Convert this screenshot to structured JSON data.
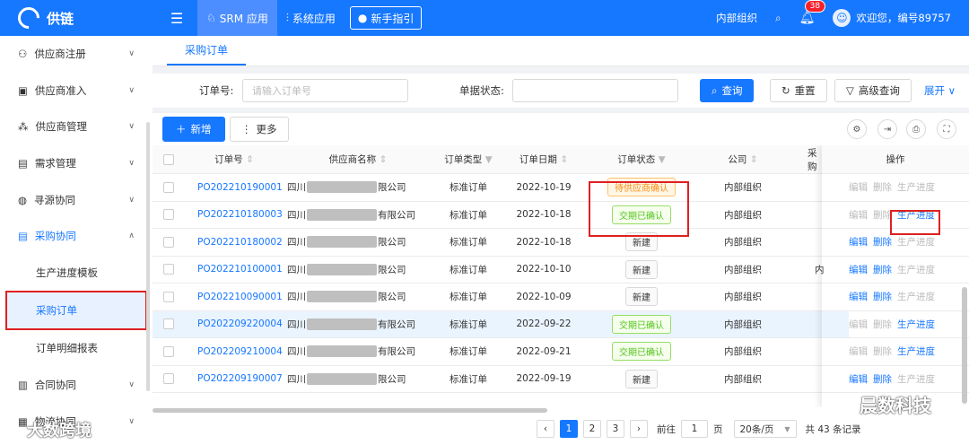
{
  "app": {
    "logo_text": "供链"
  },
  "topbar": {
    "tabs": [
      {
        "label": "SRM 应用"
      },
      {
        "label": "系统应用"
      }
    ],
    "guide_label": "新手指引",
    "org_label": "内部组织",
    "notification_count": "38",
    "welcome": "欢迎您，编号89757"
  },
  "sidebar": {
    "items": [
      {
        "label": "供应商注册"
      },
      {
        "label": "供应商准入"
      },
      {
        "label": "供应商管理"
      },
      {
        "label": "需求管理"
      },
      {
        "label": "寻源协同"
      },
      {
        "label": "采购协同"
      }
    ],
    "sub_items": [
      {
        "label": "生产进度模板"
      },
      {
        "label": "采购订单"
      },
      {
        "label": "订单明细报表"
      }
    ],
    "items_after": [
      {
        "label": "合同协同"
      },
      {
        "label": "物流协同"
      }
    ]
  },
  "page_tab": "采购订单",
  "filter": {
    "order_no_label": "订单号:",
    "order_no_placeholder": "请输入订单号",
    "status_label": "单据状态:",
    "query_label": "查询",
    "reset_label": "重置",
    "advanced_label": "高级查询",
    "expand_label": "展开"
  },
  "toolbar": {
    "add_label": "新增",
    "more_label": "更多"
  },
  "table": {
    "headers": [
      "订单号",
      "供应商名称",
      "订单类型",
      "订单日期",
      "订单状态",
      "公司",
      "采购",
      "操作"
    ],
    "rows": [
      {
        "order_no": "PO202210190001",
        "supplier_prefix": "四川",
        "supplier_suffix": "限公司",
        "type": "标准订单",
        "date": "2022-10-19",
        "status": "待供应商确认",
        "status_style": "orange",
        "company": "内部组织",
        "purchaser": "",
        "ops": [
          {
            "label": "编辑",
            "on": false
          },
          {
            "label": "删除",
            "on": false
          },
          {
            "label": "生产进度",
            "on": false
          }
        ]
      },
      {
        "order_no": "PO202210180003",
        "supplier_prefix": "四川",
        "supplier_suffix": "有限公司",
        "type": "标准订单",
        "date": "2022-10-18",
        "status": "交期已确认",
        "status_style": "green",
        "company": "内部组织",
        "purchaser": "",
        "ops": [
          {
            "label": "编辑",
            "on": false
          },
          {
            "label": "删除",
            "on": false
          },
          {
            "label": "生产进度",
            "on": true
          }
        ]
      },
      {
        "order_no": "PO202210180002",
        "supplier_prefix": "四川",
        "supplier_suffix": "限公司",
        "type": "标准订单",
        "date": "2022-10-18",
        "status": "新建",
        "status_style": "gray",
        "company": "内部组织",
        "purchaser": "",
        "ops": [
          {
            "label": "编辑",
            "on": true
          },
          {
            "label": "删除",
            "on": true
          },
          {
            "label": "生产进度",
            "on": false
          }
        ]
      },
      {
        "order_no": "PO202210100001",
        "supplier_prefix": "四川",
        "supplier_suffix": "限公司",
        "type": "标准订单",
        "date": "2022-10-10",
        "status": "新建",
        "status_style": "gray",
        "company": "内部组织",
        "purchaser": "内",
        "ops": [
          {
            "label": "编辑",
            "on": true
          },
          {
            "label": "删除",
            "on": true
          },
          {
            "label": "生产进度",
            "on": false
          }
        ]
      },
      {
        "order_no": "PO202210090001",
        "supplier_prefix": "四川",
        "supplier_suffix": "限公司",
        "type": "标准订单",
        "date": "2022-10-09",
        "status": "新建",
        "status_style": "gray",
        "company": "内部组织",
        "purchaser": "",
        "ops": [
          {
            "label": "编辑",
            "on": true
          },
          {
            "label": "删除",
            "on": true
          },
          {
            "label": "生产进度",
            "on": false
          }
        ]
      },
      {
        "order_no": "PO202209220004",
        "supplier_prefix": "四川",
        "supplier_suffix": "有限公司",
        "type": "标准订单",
        "date": "2022-09-22",
        "status": "交期已确认",
        "status_style": "green",
        "company": "内部组织",
        "purchaser": "",
        "ops": [
          {
            "label": "编辑",
            "on": false
          },
          {
            "label": "删除",
            "on": false
          },
          {
            "label": "生产进度",
            "on": true
          }
        ]
      },
      {
        "order_no": "PO202209210004",
        "supplier_prefix": "四川",
        "supplier_suffix": "有限公司",
        "type": "标准订单",
        "date": "2022-09-21",
        "status": "交期已确认",
        "status_style": "green",
        "company": "内部组织",
        "purchaser": "",
        "ops": [
          {
            "label": "编辑",
            "on": false
          },
          {
            "label": "删除",
            "on": false
          },
          {
            "label": "生产进度",
            "on": true
          }
        ]
      },
      {
        "order_no": "PO202209190007",
        "supplier_prefix": "四川",
        "supplier_suffix": "限公司",
        "type": "标准订单",
        "date": "2022-09-19",
        "status": "新建",
        "status_style": "gray",
        "company": "内部组织",
        "purchaser": "",
        "ops": [
          {
            "label": "编辑",
            "on": true
          },
          {
            "label": "删除",
            "on": true
          },
          {
            "label": "生产进度",
            "on": false
          }
        ]
      }
    ]
  },
  "pager": {
    "pages": [
      "1",
      "2",
      "3"
    ],
    "goto_label": "前往",
    "goto_value": "1",
    "page_unit": "页",
    "page_size": "20条/页",
    "total": "共 43 条记录"
  },
  "watermarks": {
    "left": "大数跨境",
    "right": "晨数科技"
  }
}
